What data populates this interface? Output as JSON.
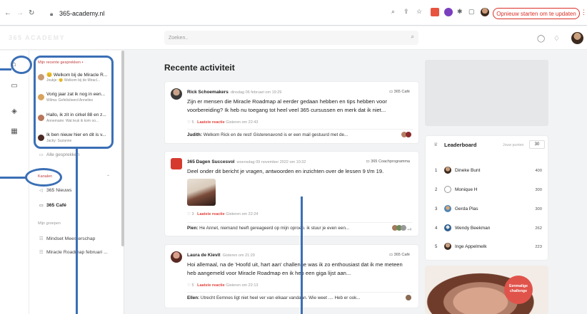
{
  "browser": {
    "url": "365-academy.nl",
    "restart_label": "Opnieuw starten om te updaten"
  },
  "app": {
    "brand": "365 ACADEMY",
    "search_placeholder": "Zoeken.."
  },
  "sidebar": {
    "recent_title": "Mijn recente gesprekken",
    "conversations": [
      {
        "title": "😊 Welkom bij de Miracle R...",
        "subtitle": "Joukje: 😊 Welkom bij de Miracl..."
      },
      {
        "title": "Vorig jaar zat ik nog in een...",
        "subtitle": "Wilma: Gefeliciteerd Annelies"
      },
      {
        "title": "Hallo, ik zit in cirkel 88 en z...",
        "subtitle": "Annemarie: Wat leuk ik kom oo..."
      },
      {
        "title": "Ik ben nieuw hier en dit is v...",
        "subtitle": "Jacky: Suzanne"
      }
    ],
    "all_conversations": "Alle gesprekken",
    "channels_label": "Kanalen",
    "channels": [
      {
        "label": "365 Nieuws"
      },
      {
        "label": "365 Café"
      }
    ],
    "groups_label": "Mijn groepen",
    "groups": [
      {
        "label": "Mindset Meesterschap"
      },
      {
        "label": "Miracle Roadmap februari ..."
      }
    ]
  },
  "feed": {
    "title": "Recente activiteit",
    "posts": [
      {
        "author": "Rick Schoemakers",
        "date": "dinsdag 06 februari om 19:29",
        "channel": "365 Café",
        "body": "Zijn er mensen die Miracle Roadmap al eerder gedaan hebben en tips hebben voor voorbereiding? Ik heb nu toegang tot heel veel 365 cursussen en merk dat ik niet...",
        "likes": "5",
        "last_reply_label": "Laatste reactie",
        "last_reply_time": "Gisteren om 22:43",
        "reply_author": "Judith:",
        "reply_text": "Welkom Rick en de rest! Gisterenavond is er een mail gestuurd met de..."
      },
      {
        "author": "365 Dagen Succesvol",
        "date": "woensdag 09 november 2022 om 10:32",
        "channel": "365 Coachprogramma",
        "body": "Deel onder dit bericht je vragen, antwoorden en inzichten over de lessen 9 t/m 19.",
        "likes": "3",
        "last_reply_label": "Laatste reactie",
        "last_reply_time": "Gisteren om 22:24",
        "reply_author": "Pien:",
        "reply_text": "He Annet, niemand heeft gereageerd op mijn oproep. ik stuur je even een...",
        "reply_more": "+4"
      },
      {
        "author": "Laura de Kievit",
        "date": "Gisteren om 21:29",
        "channel": "365 Café",
        "body": "Hoi allemaal, na de 'Hoofd uit, hart aan' challenge was ik zo enthousiast dat ik me meteen heb aangemeld voor Miracle Roadmap en ik heb een giga lijst aan...",
        "likes": "5",
        "last_reply_label": "Laatste reactie",
        "last_reply_time": "Gisteren om 22:13",
        "reply_author": "Ellen:",
        "reply_text": "Utrecht Eemnes ligt niet heel ver van elkaar vandaan. Wie weet .... Heb er ook..."
      }
    ]
  },
  "leaderboard": {
    "title": "Leaderboard",
    "points_label": "Jouw punten",
    "my_points": "30",
    "rows": [
      {
        "rank": "1",
        "name": "Dineke Bunt",
        "points": "400"
      },
      {
        "rank": "2",
        "name": "Monique H",
        "points": "300"
      },
      {
        "rank": "3",
        "name": "Gerda Plas",
        "points": "300"
      },
      {
        "rank": "4",
        "name": "Wendy Beekman",
        "points": "262"
      },
      {
        "rank": "5",
        "name": "Inge Appelmelk",
        "points": "223"
      }
    ]
  },
  "promo": {
    "badge": "Eenmalige challenge"
  },
  "colors": {
    "accent": "#e0443e",
    "annotation": "#3b6fb5"
  }
}
